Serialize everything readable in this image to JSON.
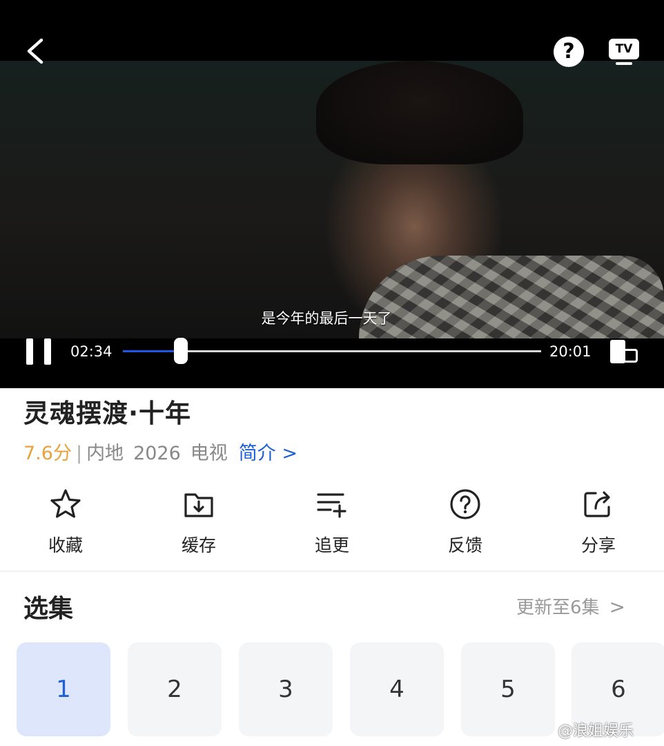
{
  "player": {
    "subtitle": "是今年的最后一天了",
    "current_time": "02:34",
    "total_time": "20:01",
    "progress": 0.138,
    "help_icon": "question-circle-icon",
    "tv_label": "TV",
    "back_icon": "chevron-left-icon",
    "rotate_icon": "screen-rotate-icon"
  },
  "show": {
    "title": "灵魂摆渡·十年",
    "score": "7.6分",
    "separator": "|",
    "region": "内地",
    "year": "2026",
    "category": "电视",
    "intro_link": "简介 >"
  },
  "actions": [
    {
      "label": "收藏",
      "icon": "star-icon"
    },
    {
      "label": "缓存",
      "icon": "download-folder-icon"
    },
    {
      "label": "追更",
      "icon": "playlist-add-icon"
    },
    {
      "label": "反馈",
      "icon": "question-circle-icon"
    },
    {
      "label": "分享",
      "icon": "share-icon"
    }
  ],
  "episodes": {
    "title": "选集",
    "update_text": "更新至6集",
    "update_chevron": ">",
    "items": [
      "1",
      "2",
      "3",
      "4",
      "5",
      "6"
    ],
    "selected": "1"
  },
  "watermark": "@浪姐娱乐",
  "colors": {
    "accent": "#1f5fd6",
    "score": "#e8a23c",
    "seek_fill": "#1e57e6",
    "selected_episode_bg": "#dde6fb"
  }
}
